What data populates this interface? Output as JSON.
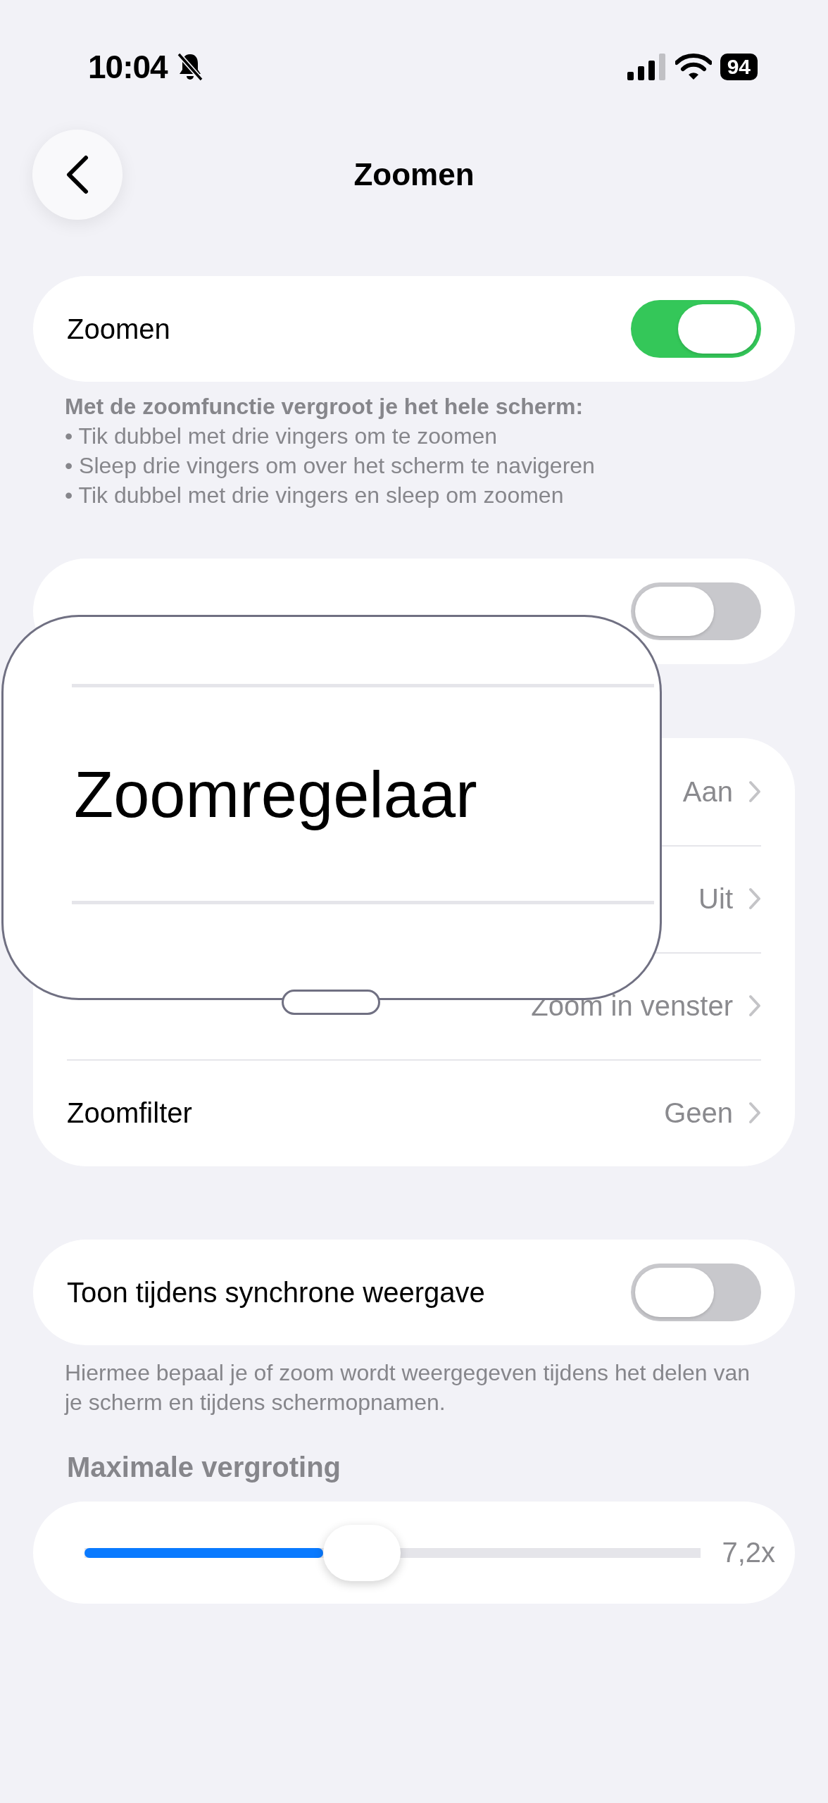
{
  "status_bar": {
    "time": "10:04",
    "battery": "94"
  },
  "nav": {
    "title": "Zoomen"
  },
  "zoom_group": {
    "label": "Zoomen",
    "on": true
  },
  "zoom_footer": {
    "intro": "Met de zoomfunctie vergroot je het hele scherm:",
    "bullets": [
      "• Tik dubbel met drie vingers om te zoomen",
      "• Sleep drie vingers om over het scherm te navigeren",
      "• Tik dubbel met drie vingers en sleep om zoomen"
    ]
  },
  "follow_focus": {
    "on": false
  },
  "options": [
    {
      "value": "Aan"
    },
    {
      "value": "Uit"
    },
    {
      "value": "Zoom in venster"
    },
    {
      "label": "Zoomfilter",
      "value": "Geen"
    }
  ],
  "mirroring": {
    "label": "Toon tijdens synchrone weergave",
    "on": false
  },
  "mirroring_footer": "Hiermee bepaal je of zoom wordt weergegeven tijdens het delen van je scherm en tijdens schermopnamen.",
  "max_zoom": {
    "header": "Maximale vergroting",
    "level": 0.45,
    "reading": "7,2x"
  },
  "zoom_window": {
    "label": "Zoomregelaar"
  }
}
